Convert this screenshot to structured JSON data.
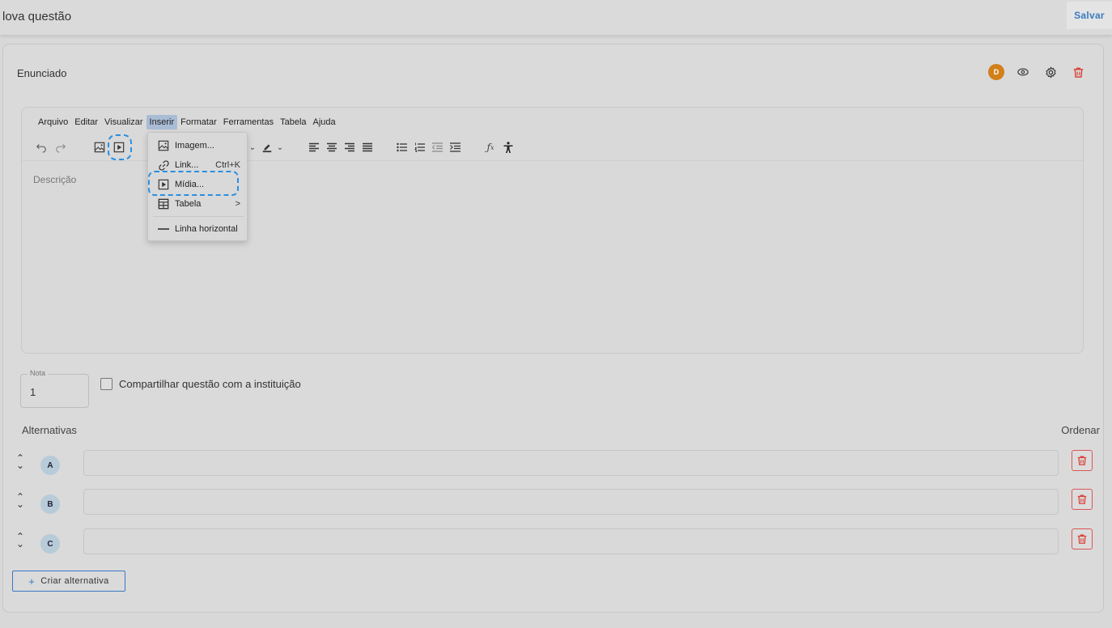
{
  "header": {
    "title": "lova questão",
    "save_label": "Salvar"
  },
  "card": {
    "section_title": "Enunciado",
    "avatar_initial": "D",
    "icons": [
      "eye-icon",
      "gear-icon",
      "trash-icon"
    ]
  },
  "editor": {
    "menubar": [
      "Arquivo",
      "Editar",
      "Visualizar",
      "Inserir",
      "Formatar",
      "Ferramentas",
      "Tabela",
      "Ajuda"
    ],
    "active_menu": "Inserir",
    "placeholder": "Descrição",
    "insert_menu": {
      "items": [
        {
          "label": "Imagem...",
          "icon": "image-icon",
          "shortcut": ""
        },
        {
          "label": "Link...",
          "icon": "link-icon",
          "shortcut": "Ctrl+K"
        },
        {
          "label": "Mídia...",
          "icon": "media-play-icon",
          "shortcut": ""
        },
        {
          "label": "Tabela",
          "icon": "table-icon",
          "shortcut": ">"
        },
        {
          "label": "Linha horizontal",
          "icon": "horizontal-line-icon",
          "shortcut": ""
        }
      ]
    }
  },
  "grade": {
    "label": "Nota",
    "value": "1"
  },
  "share": {
    "label": "Compartilhar questão com a instituição",
    "checked": false
  },
  "alternatives": {
    "title": "Alternativas",
    "order_label": "Ordenar",
    "items": [
      {
        "letter": "A",
        "value": ""
      },
      {
        "letter": "B",
        "value": ""
      },
      {
        "letter": "C",
        "value": ""
      }
    ],
    "create_label": "Criar alternativa"
  },
  "colors": {
    "accent": "#3a7bbf",
    "danger": "#d9433b",
    "avatar": "#d2801a",
    "highlight": "#2a8fe0"
  }
}
